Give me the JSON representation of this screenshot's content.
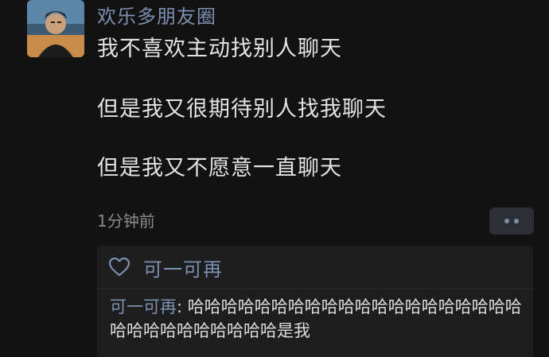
{
  "post": {
    "username": "欢乐多朋友圈",
    "content": [
      "我不喜欢主动找别人聊天",
      "但是我又很期待别人找我聊天",
      "但是我又不愿意一直聊天"
    ],
    "time": "1分钟前",
    "more_icon": "more-dots-icon"
  },
  "likes": {
    "icon": "heart-outline-icon",
    "names": "可一可再"
  },
  "comments": [
    {
      "author": "可一可再",
      "separator": ": ",
      "text": "哈哈哈哈哈哈哈哈哈哈哈哈哈哈哈哈哈哈哈哈哈哈哈哈哈哈哈哈哈哈是我"
    }
  ],
  "colors": {
    "background": "#121212",
    "name_blue": "#7b8fb0",
    "text": "#e4e4e4",
    "muted": "#8a8a8a",
    "panel": "#1e1e1e"
  }
}
